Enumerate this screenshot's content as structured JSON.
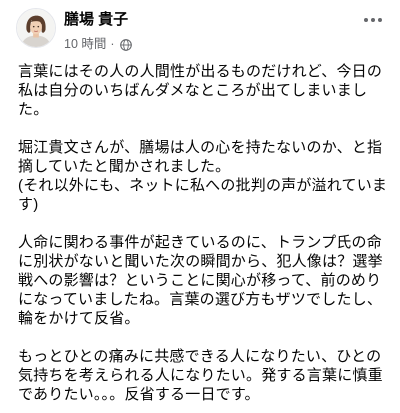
{
  "post": {
    "author": {
      "name": "膳場 貴子",
      "avatar_icon": "profile-photo"
    },
    "meta": {
      "time": "10 時間",
      "separator": "·",
      "audience_icon": "globe-icon"
    },
    "actions": {
      "more_icon": "more-horizontal-icon"
    },
    "paragraphs": [
      {
        "lines": [
          "言葉にはその人の人間性が出るものだけれど、今日の",
          "私は自分のいちばんダメなところが出てしまいまし",
          "た。"
        ]
      },
      {
        "lines": [
          "堀江貴文さんが、膳場は人の心を持たないのか、と指",
          "摘していたと聞かされました。",
          "(それ以外にも、ネットに私への批判の声が溢れていま",
          "す)"
        ]
      },
      {
        "lines": [
          "人命に関わる事件が起きているのに、トランプ氏の命",
          "に別状がないと聞いた次の瞬間から、犯人像は？選挙",
          "戦への影響は？ということに関心が移って、前のめり",
          "になっていましたね。言葉の選び方もザツでしたし、",
          "輪をかけて反省。"
        ]
      },
      {
        "lines": [
          "もっとひとの痛みに共感できる人になりたい、ひとの",
          "気持ちを考えられる人になりたい。発する言葉に慎重",
          "でありたい。。。反省する一日です。"
        ]
      }
    ]
  },
  "colors": {
    "background": "#ffffff",
    "primary_text": "#050505",
    "secondary_text": "#65676b"
  }
}
